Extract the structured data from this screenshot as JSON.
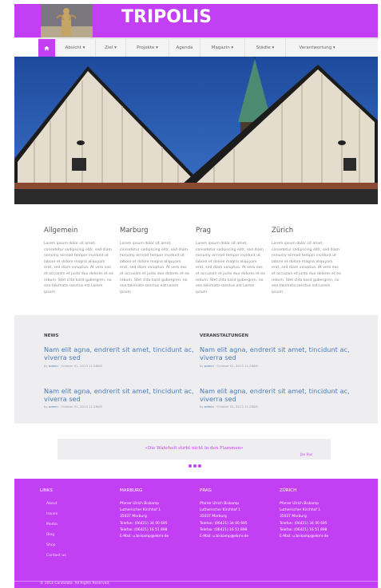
{
  "header": {
    "brand": "TRIPOLIS"
  },
  "nav": {
    "items": [
      {
        "label": "Absicht ▾"
      },
      {
        "label": "Ziel ▾"
      },
      {
        "label": "Projekte ▾"
      },
      {
        "label": "Agenda"
      },
      {
        "label": "Magazin ▾"
      },
      {
        "label": "Städte ▾"
      },
      {
        "label": "Verantwortung ▾"
      }
    ]
  },
  "columns": [
    {
      "title": "Allgemein",
      "text": "Lorem ipsum dolor sit amet, consetetur sadipscing elitr, sed diam nonumy eirmod tempor invidunt ut labore et dolore magna aliquyam erat, sed diam voluptua. At vero eos et accusam et justo duo dolores et ea rebum. Stet clita kasd gubergren, no sea takimata sanctus est Lorem ipsum"
    },
    {
      "title": "Marburg",
      "text": "Lorem ipsum dolor sit amet, consetetur sadipscing elitr, sed diam nonumy eirmod tempor invidunt ut labore et dolore magna aliquyam erat, sed diam voluptua. At vero eos et accusam et justo duo dolores et ea rebum. Stet clita kasd gubergren, no sea takimata sanctus est Lorem ipsum"
    },
    {
      "title": "Prag",
      "text": "Lorem ipsum dolor sit amet, consetetur sadipscing elitr, sed diam nonumy eirmod tempor invidunt ut labore et dolore magna aliquyam erat, sed diam voluptua. At vero eos et accusam et justo duo dolores et ea rebum. Stet clita kasd gubergren, no sea takimata sanctus est Lorem ipsum"
    },
    {
      "title": "Zürich",
      "text": "Lorem ipsum dolor sit amet, consetetur sadipscing elitr, sed diam nonumy eirmod tempor invidunt ut labore et dolore magna aliquyam erat, sed diam voluptua. At vero eos et accusam et justo duo dolores et ea rebum. Stet clita kasd gubergren, no sea takimata sanctus est Lorem ipsum"
    }
  ],
  "news": {
    "title": "NEWS",
    "items": [
      {
        "headline": "Nam elit agna, endrerit sit amet, tincidunt ac, viverra sed",
        "by": "by",
        "author": "admin",
        "date": "· October 01, 2013 11:28AM"
      },
      {
        "headline": "Nam elit agna, endrerit sit amet, tincidunt ac, viverra sed",
        "by": "by",
        "author": "admin",
        "date": "· October 01, 2013 11:28AM"
      }
    ]
  },
  "events": {
    "title": "VERANSTALTUNGEN",
    "items": [
      {
        "headline": "Nam elit agna, endrerit sit amet, tincidunt ac, viverra sed",
        "by": "by",
        "author": "admin",
        "date": "· October 01, 2013 11:28AM"
      },
      {
        "headline": "Nam elit agna, endrerit sit amet, tincidunt ac, viverra sed",
        "by": "by",
        "author": "admin",
        "date": "· October 01, 2013 11:28AM"
      }
    ]
  },
  "quote": {
    "text": "«Die Wahrheit stirbt nicht in den Flammen»",
    "author": "Jan Hus"
  },
  "footer": {
    "links_title": "LINKS",
    "links": [
      "About",
      "Issues",
      "Media",
      "Blog",
      "Shop",
      "Contact us"
    ],
    "cities": [
      {
        "title": "MARBURG",
        "lines": [
          "Pfarrer Ulrich Biskamp",
          "Lutherischer Kirchhof 1",
          "35037 Marburg",
          "Telefon: (06421) 34 00 695",
          "Telefax: (06421) 16 51 898",
          "E-Mail: u.biskamp@ekmr.de"
        ]
      },
      {
        "title": "PRAG",
        "lines": [
          "Pfarrer Ulrich Biskamp",
          "Lutherischer Kirchhof 1",
          "35037 Marburg",
          "Telefon: (06421) 34 00 695",
          "Telefax: (06421) 16 51 898",
          "E-Mail: u.biskamp@ekmr.de"
        ]
      },
      {
        "title": "ZÜRICH",
        "lines": [
          "Pfarrer Ulrich Biskamp",
          "Lutherischer Kirchhof 1",
          "35037 Marburg",
          "Telefon: (06421) 34 00 695",
          "Telefax: (06421) 16 51 898",
          "E-Mail: u.biskamp@ekmr.de"
        ]
      }
    ],
    "copyright": "© 2014 Candidate. All Rights Reserved."
  },
  "colors": {
    "accent": "#c23ff3",
    "link": "#4a7cb7",
    "band": "#eeeef1"
  }
}
